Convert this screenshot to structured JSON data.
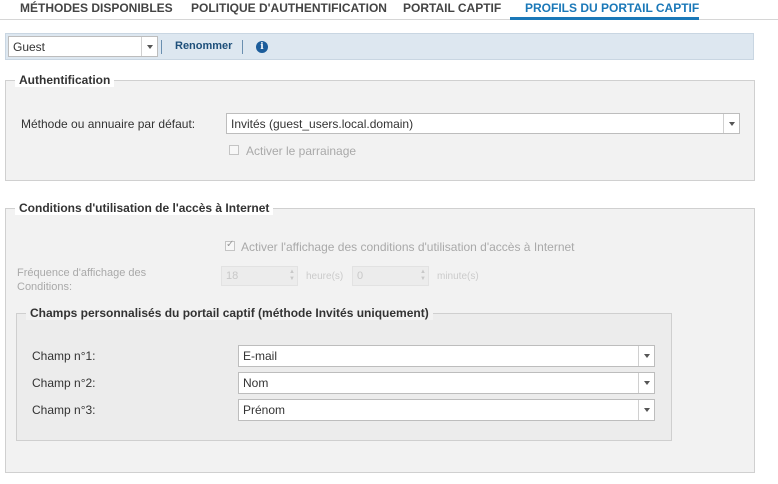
{
  "tabs": [
    {
      "label": "MÉTHODES DISPONIBLES",
      "active": false
    },
    {
      "label": "POLITIQUE D'AUTHENTIFICATION",
      "active": false
    },
    {
      "label": "PORTAIL CAPTIF",
      "active": false
    },
    {
      "label": "PROFILS DU PORTAIL CAPTIF",
      "active": true
    }
  ],
  "toolbar": {
    "profile_select_value": "Guest",
    "rename_label": "Renommer",
    "info_icon": "info-icon"
  },
  "auth_section": {
    "legend": "Authentification",
    "default_method_label": "Méthode ou annuaire par défaut:",
    "default_method_value": "Invités (guest_users.local.domain)",
    "sponsorship_label": "Activer le parrainage",
    "sponsorship_checked": false
  },
  "conditions_section": {
    "legend": "Conditions d'utilisation de l'accès à Internet",
    "enable_conditions_label": "Activer l'affichage des conditions d'utilisation d'accès à Internet",
    "enable_conditions_checked": true,
    "frequency_label_line1": "Fréquence d'affichage des",
    "frequency_label_line2": "Conditions:",
    "hours_value": "18",
    "hours_unit": "heure(s)",
    "minutes_value": "0",
    "minutes_unit": "minute(s)"
  },
  "custom_fields_section": {
    "legend": "Champs personnalisés du portail captif (méthode Invités uniquement)",
    "fields": [
      {
        "label": "Champ n°1:",
        "value": "E-mail"
      },
      {
        "label": "Champ n°2:",
        "value": "Nom"
      },
      {
        "label": "Champ n°3:",
        "value": "Prénom"
      }
    ]
  },
  "colors": {
    "accent": "#1a78b8",
    "toolbar_bg": "#dde7f0",
    "panel_bg": "#f2f2f2",
    "inner_panel_bg": "#ececec"
  }
}
